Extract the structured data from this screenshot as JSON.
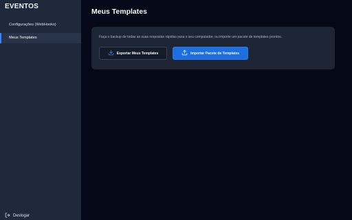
{
  "sidebar": {
    "brand": "EVENTOS",
    "items": [
      {
        "label": "Configurações (WebHooks)",
        "active": false
      },
      {
        "label": "Meus Templates",
        "active": true
      }
    ],
    "logout_label": "Deslogar"
  },
  "main": {
    "title": "Meus Templates",
    "card": {
      "description": "Faça o backup de todas as suas respostas rápidas para o seu computador, ou importe um pacote de templates prontos.",
      "export_label": "Exportar Meus Templates",
      "import_label": "Importar Pacote de Templates"
    }
  },
  "icons": {
    "export": "download-icon",
    "import": "upload-icon",
    "logout": "logout-icon"
  },
  "colors": {
    "accent": "#1d6fe0",
    "sidebar_bg": "#1e293b",
    "page_bg": "#050816"
  }
}
